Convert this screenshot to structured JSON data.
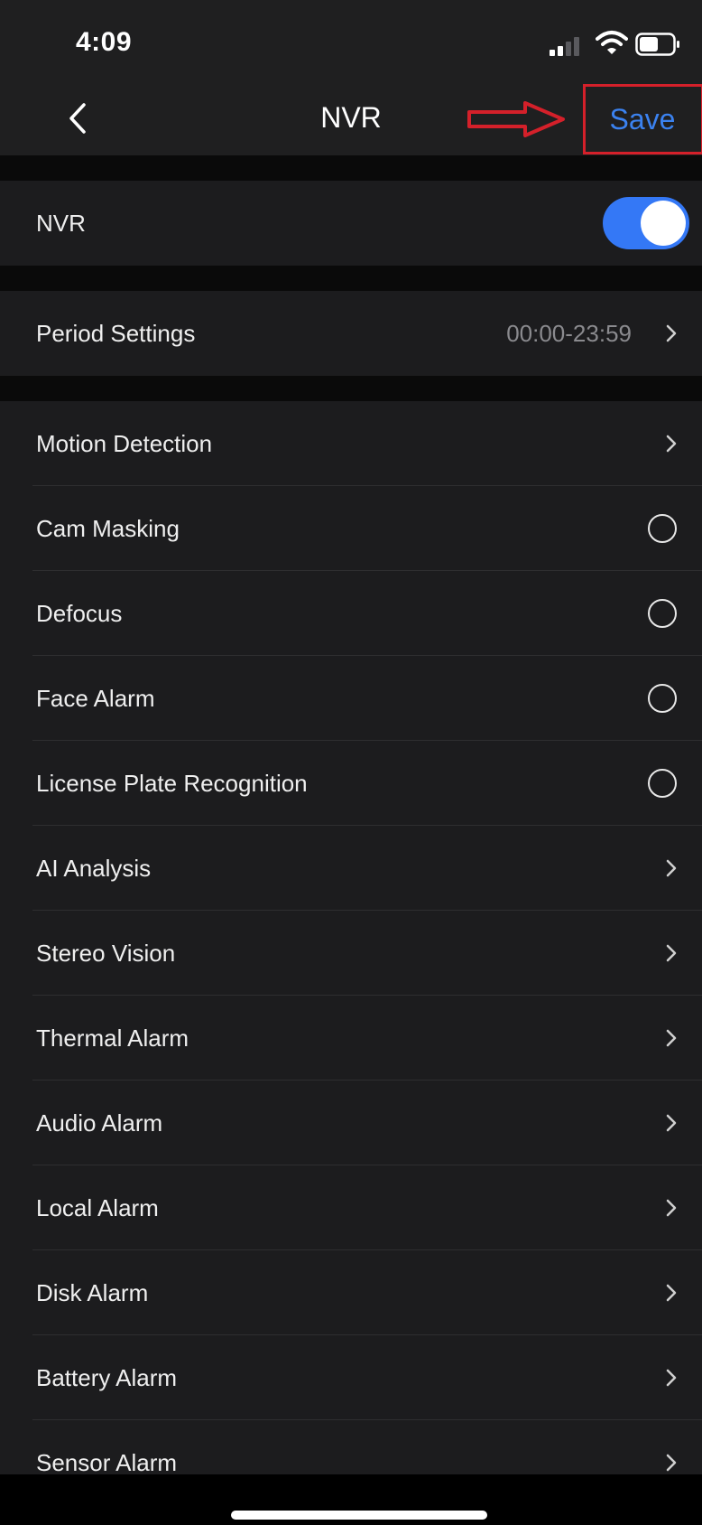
{
  "status_bar": {
    "time": "4:09",
    "icons": [
      "cellular-signal-icon",
      "wifi-icon",
      "battery-icon"
    ]
  },
  "nav": {
    "back_icon": "chevron-left-icon",
    "title": "NVR",
    "save_label": "Save",
    "annotation": "red-arrow-icon pointing to Save",
    "accent_color": "#3b82f0",
    "annotation_color": "#d4202a"
  },
  "nvr_switch": {
    "label": "NVR",
    "on": true,
    "toggle_color": "#3478f6"
  },
  "period": {
    "label": "Period Settings",
    "value": "00:00-23:59"
  },
  "items": [
    {
      "label": "Motion Detection",
      "control": "chevron"
    },
    {
      "label": "Cam Masking",
      "control": "radio",
      "checked": false
    },
    {
      "label": "Defocus",
      "control": "radio",
      "checked": false
    },
    {
      "label": "Face Alarm",
      "control": "radio",
      "checked": false
    },
    {
      "label": "License Plate Recognition",
      "control": "radio",
      "checked": false
    },
    {
      "label": "AI Analysis",
      "control": "chevron"
    },
    {
      "label": "Stereo Vision",
      "control": "chevron"
    },
    {
      "label": "Thermal Alarm",
      "control": "chevron"
    },
    {
      "label": "Audio Alarm",
      "control": "chevron"
    },
    {
      "label": "Local Alarm",
      "control": "chevron"
    },
    {
      "label": "Disk Alarm",
      "control": "chevron"
    },
    {
      "label": "Battery Alarm",
      "control": "chevron"
    },
    {
      "label": "Sensor Alarm",
      "control": "chevron"
    }
  ]
}
